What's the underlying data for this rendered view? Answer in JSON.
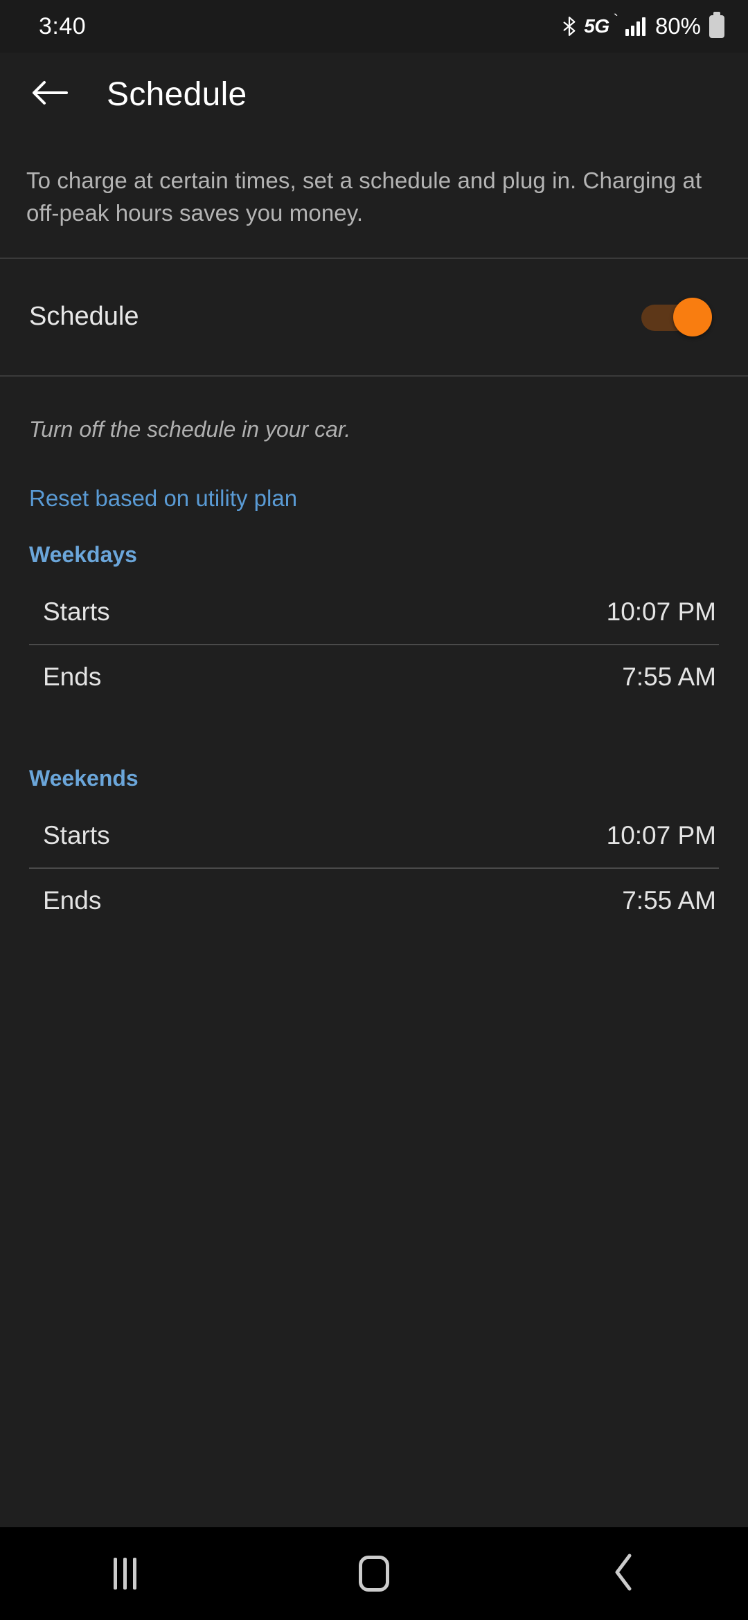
{
  "status_bar": {
    "time": "3:40",
    "bluetooth_icon": "bluetooth-icon",
    "network": "5G",
    "network_mark": "`",
    "signal_icon": "signal-bars-icon",
    "battery_percent": "80%",
    "battery_icon": "battery-icon"
  },
  "app_bar": {
    "back_icon": "back-arrow-icon",
    "title": "Schedule"
  },
  "description": "To charge at certain times, set a schedule and plug in. Charging at off-peak hours saves you money.",
  "schedule_toggle": {
    "label": "Schedule",
    "state": "on",
    "track_color": "#5d3718",
    "thumb_color": "#f97d10"
  },
  "note": "Turn off the schedule in your car.",
  "reset_link": {
    "label": "Reset based on utility plan",
    "color": "#5a9bd5"
  },
  "sections": [
    {
      "title": "Weekdays",
      "rows": [
        {
          "label": "Starts",
          "value": "10:07 PM"
        },
        {
          "label": "Ends",
          "value": "7:55 AM"
        }
      ]
    },
    {
      "title": "Weekends",
      "rows": [
        {
          "label": "Starts",
          "value": "10:07 PM"
        },
        {
          "label": "Ends",
          "value": "7:55 AM"
        }
      ]
    }
  ],
  "nav_bar": {
    "recents_icon": "recents-icon",
    "home_icon": "home-icon",
    "back_icon": "nav-back-icon"
  }
}
